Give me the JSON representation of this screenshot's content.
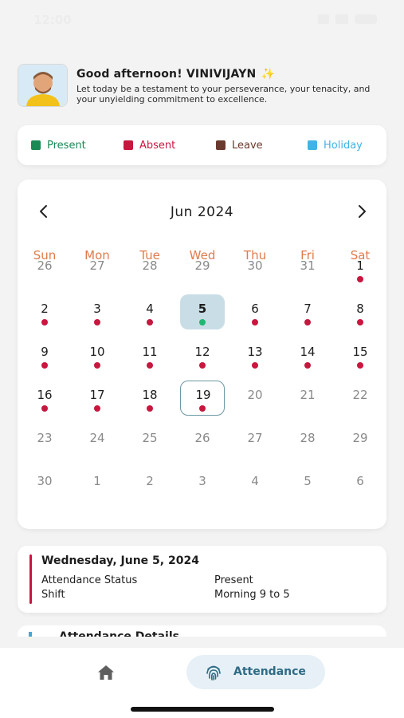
{
  "status_bar": {
    "time": "12:00"
  },
  "greeting": {
    "title": "Good afternoon! VINIVIJAYN",
    "sparkle": "✨",
    "subtitle": "Let today be a testament to your perseverance, your tenacity, and your unyielding commitment to excellence."
  },
  "legend": [
    {
      "label": "Present",
      "color": "#1a8a55"
    },
    {
      "label": "Absent",
      "color": "#c8173f"
    },
    {
      "label": "Leave",
      "color": "#6b3a2e"
    },
    {
      "label": "Holiday",
      "color": "#3fb4e6"
    }
  ],
  "calendar": {
    "month": "Jun 2024",
    "prev_icon": "chevron-left-icon",
    "next_icon": "chevron-right-icon",
    "weekdays": [
      "Sun",
      "Mon",
      "Tue",
      "Wed",
      "Thu",
      "Fri",
      "Sat"
    ],
    "status_colors": {
      "absent": "#c8173f",
      "present": "#1fb872"
    },
    "days": [
      {
        "n": "26",
        "muted": true
      },
      {
        "n": "27",
        "muted": true
      },
      {
        "n": "28",
        "muted": true
      },
      {
        "n": "29",
        "muted": true
      },
      {
        "n": "30",
        "muted": true
      },
      {
        "n": "31",
        "muted": true
      },
      {
        "n": "1",
        "status": "absent"
      },
      {
        "n": "2",
        "status": "absent"
      },
      {
        "n": "3",
        "status": "absent"
      },
      {
        "n": "4",
        "status": "absent"
      },
      {
        "n": "5",
        "status": "present",
        "selected": true
      },
      {
        "n": "6",
        "status": "absent"
      },
      {
        "n": "7",
        "status": "absent"
      },
      {
        "n": "8",
        "status": "absent"
      },
      {
        "n": "9",
        "status": "absent"
      },
      {
        "n": "10",
        "status": "absent"
      },
      {
        "n": "11",
        "status": "absent"
      },
      {
        "n": "12",
        "status": "absent"
      },
      {
        "n": "13",
        "status": "absent"
      },
      {
        "n": "14",
        "status": "absent"
      },
      {
        "n": "15",
        "status": "absent"
      },
      {
        "n": "16",
        "status": "absent"
      },
      {
        "n": "17",
        "status": "absent"
      },
      {
        "n": "18",
        "status": "absent"
      },
      {
        "n": "19",
        "status": "absent",
        "today": true
      },
      {
        "n": "20",
        "muted": true
      },
      {
        "n": "21",
        "muted": true
      },
      {
        "n": "22",
        "muted": true
      },
      {
        "n": "23",
        "muted": true
      },
      {
        "n": "24",
        "muted": true
      },
      {
        "n": "25",
        "muted": true
      },
      {
        "n": "26",
        "muted": true
      },
      {
        "n": "27",
        "muted": true
      },
      {
        "n": "28",
        "muted": true
      },
      {
        "n": "29",
        "muted": true
      },
      {
        "n": "30",
        "muted": true
      },
      {
        "n": "1",
        "muted": true
      },
      {
        "n": "2",
        "muted": true
      },
      {
        "n": "3",
        "muted": true
      },
      {
        "n": "4",
        "muted": true
      },
      {
        "n": "5",
        "muted": true
      },
      {
        "n": "6",
        "muted": true
      }
    ]
  },
  "detail": {
    "date": "Wednesday, June 5, 2024",
    "status_label": "Attendance Status",
    "status_value": "Present",
    "shift_label": "Shift",
    "shift_value": "Morning 9 to 5",
    "accent": "#c8173f"
  },
  "next_section": {
    "title": "Attendance Details"
  },
  "bottom_nav": {
    "home_icon": "home-icon",
    "attendance_icon": "fingerprint-icon",
    "attendance_label": "Attendance"
  }
}
